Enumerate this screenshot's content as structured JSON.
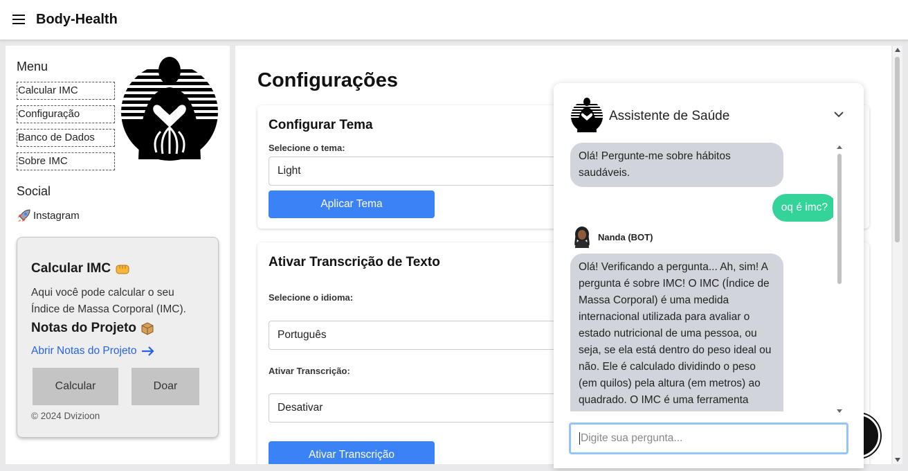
{
  "app": {
    "title": "Body-Health"
  },
  "sidebar": {
    "menu_title": "Menu",
    "items": [
      {
        "label": "Calcular IMC"
      },
      {
        "label": "Configuração"
      },
      {
        "label": "Banco de Dados"
      },
      {
        "label": "Sobre IMC"
      }
    ],
    "social_title": "Social",
    "social_links": [
      {
        "label": "Instagram",
        "icon": "rocket-icon"
      }
    ],
    "imc_card": {
      "title": "Calcular IMC",
      "title_icon": "fist-icon",
      "description": "Aqui você pode calcular o seu Índice de Massa Corporal (IMC).",
      "notes_title": "Notas do Projeto",
      "notes_icon": "box-icon",
      "notes_link": "Abrir Notas do Projeto",
      "calc_button": "Calcular",
      "donate_button": "Doar",
      "copyright": "© 2024 Dvizioon"
    }
  },
  "main": {
    "page_title": "Configurações",
    "theme_card": {
      "title": "Configurar Tema",
      "label": "Selecione o tema:",
      "selected": "Light",
      "button": "Aplicar Tema"
    },
    "transcription_card": {
      "title": "Ativar Transcrição de Texto",
      "language_label": "Selecione o idioma:",
      "language_selected": "Português",
      "toggle_label": "Ativar Transcrição:",
      "toggle_selected": "Desativar",
      "button": "Ativar Transcrição"
    }
  },
  "chat": {
    "title": "Assistente de Saúde",
    "messages": [
      {
        "from": "bot",
        "text": "Olá! Pergunte-me sobre hábitos saudáveis."
      },
      {
        "from": "user",
        "text": "oq é imc?"
      },
      {
        "from": "bot",
        "name": "Nanda (BOT)",
        "text": "Olá! Verificando a pergunta... Ah, sim! A pergunta é sobre IMC! O IMC (Índice de Massa Corporal) é uma medida internacional utilizada para avaliar o estado nutricional de uma pessoa, ou seja, se ela está dentro do peso ideal ou não. Ele é calculado dividindo o peso (em quilos) pela altura (em metros) ao quadrado. O IMC é uma ferramenta"
      }
    ],
    "input_placeholder": "Digite sua pergunta..."
  },
  "colors": {
    "primary_button": "#3b82f6",
    "user_bubble": "#34d399",
    "bot_bubble": "#d1d5db",
    "link": "#2563eb"
  }
}
